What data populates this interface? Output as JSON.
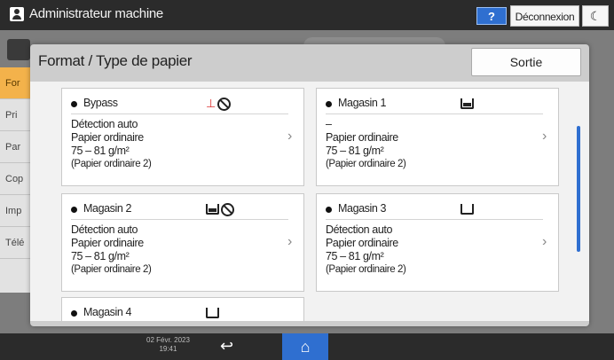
{
  "header": {
    "app_title": "Administrateur machine",
    "help_label": "?",
    "logout_label": "Déconnexion",
    "moon_label": "☾"
  },
  "background": {
    "sidebar_items": [
      "For",
      "Pri",
      "Par",
      "Cop",
      "Imp",
      "Télé"
    ]
  },
  "dialog": {
    "title": "Format / Type de papier",
    "exit_label": "Sortie",
    "cards": [
      {
        "name": "Bypass",
        "icons": [
          "bypass-tray-icon",
          "no-entry-icon"
        ],
        "lines": [
          "Détection auto",
          "Papier ordinaire",
          "75 – 81 g/m²",
          "(Papier ordinaire 2)"
        ]
      },
      {
        "name": "Magasin 1",
        "icons": [
          "paper-tray-full-icon"
        ],
        "lines": [
          "–",
          "Papier ordinaire",
          "75 – 81 g/m²",
          "(Papier ordinaire 2)"
        ]
      },
      {
        "name": "Magasin 2",
        "icons": [
          "paper-tray-full-icon",
          "no-entry-icon"
        ],
        "lines": [
          "Détection auto",
          "Papier ordinaire",
          "75 – 81 g/m²",
          "(Papier ordinaire 2)"
        ]
      },
      {
        "name": "Magasin 3",
        "icons": [
          "paper-tray-empty-icon"
        ],
        "lines": [
          "Détection auto",
          "Papier ordinaire",
          "75 – 81 g/m²",
          "(Papier ordinaire 2)"
        ]
      }
    ],
    "partial_card": {
      "name": "Magasin 4",
      "icons": [
        "paper-tray-empty-icon"
      ]
    }
  },
  "footer": {
    "date": "02 Févr. 2023",
    "time": "19:41",
    "back_icon": "back-arrow-icon",
    "home_icon": "home-icon"
  }
}
